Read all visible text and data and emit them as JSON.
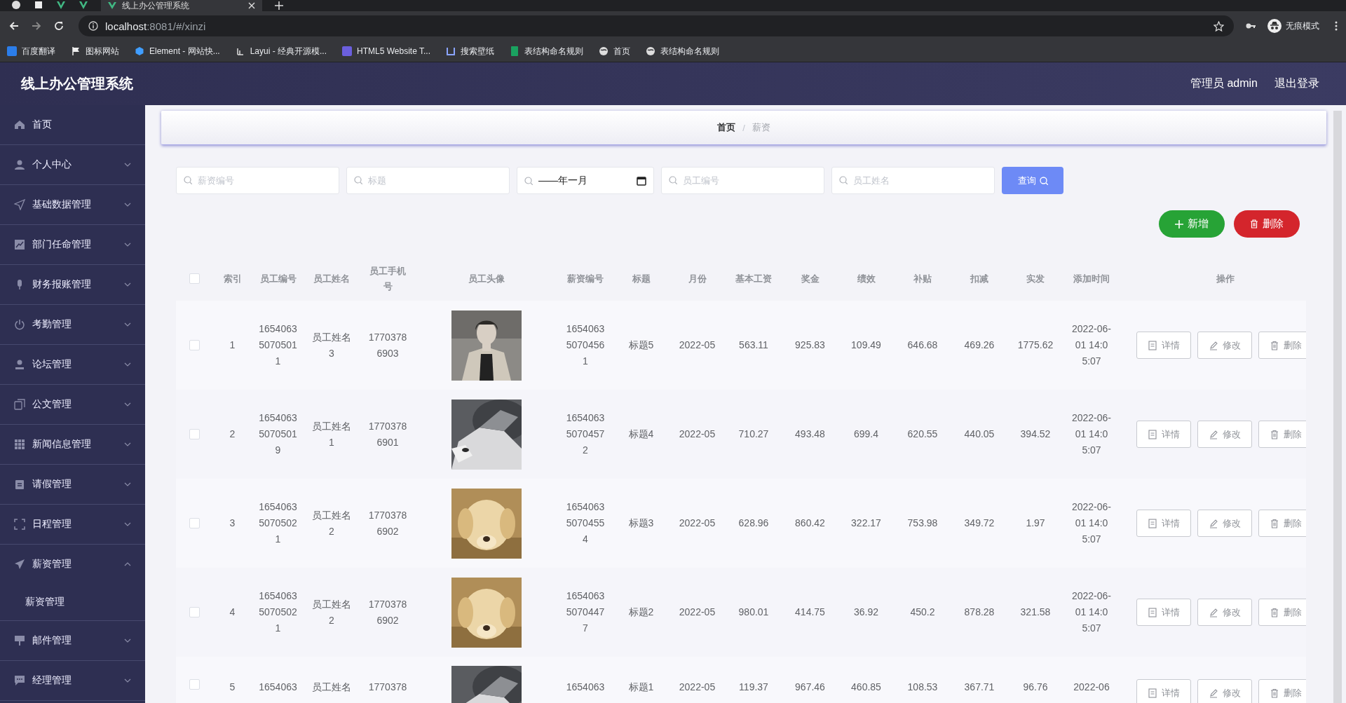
{
  "browser": {
    "tab": {
      "title": "线上办公管理系统",
      "selected": true
    },
    "url_host": "localhost",
    "url_path": ":8081/#/xinzi",
    "profile": "无痕模式",
    "bookmarks": [
      "百度翻译",
      "图标网站",
      "Element - 网站快...",
      "Layui - 经典开源模...",
      "HTML5 Website T...",
      "搜索壁纸",
      "表结构命名规则",
      "首页",
      "表结构命名规则"
    ]
  },
  "header": {
    "title": "线上办公管理系统",
    "user": "管理员 admin",
    "logout": "退出登录"
  },
  "sidebar": {
    "items": [
      {
        "label": "首页",
        "kind": "link"
      },
      {
        "label": "个人中心",
        "kind": "menu",
        "expanded": false
      },
      {
        "label": "基础数据管理",
        "kind": "menu",
        "expanded": false
      },
      {
        "label": "部门任命管理",
        "kind": "menu",
        "expanded": false
      },
      {
        "label": "财务报账管理",
        "kind": "menu",
        "expanded": false
      },
      {
        "label": "考勤管理",
        "kind": "menu",
        "expanded": false
      },
      {
        "label": "论坛管理",
        "kind": "menu",
        "expanded": false
      },
      {
        "label": "公文管理",
        "kind": "menu",
        "expanded": false
      },
      {
        "label": "新闻信息管理",
        "kind": "menu",
        "expanded": false
      },
      {
        "label": "请假管理",
        "kind": "menu",
        "expanded": false
      },
      {
        "label": "日程管理",
        "kind": "menu",
        "expanded": false
      },
      {
        "label": "薪资管理",
        "kind": "menu",
        "expanded": true,
        "children": [
          {
            "label": "薪资管理"
          }
        ]
      },
      {
        "label": "邮件管理",
        "kind": "menu",
        "expanded": false
      },
      {
        "label": "经理管理",
        "kind": "menu",
        "expanded": false
      }
    ]
  },
  "breadcrumb": [
    "首页",
    "薪资"
  ],
  "breadcrumb_separator": "/",
  "filters": [
    {
      "kind": "text",
      "placeholder": "薪资编号"
    },
    {
      "kind": "text",
      "placeholder": "标题"
    },
    {
      "kind": "month",
      "placeholder": "——年一月"
    },
    {
      "kind": "text",
      "placeholder": "员工编号"
    },
    {
      "kind": "text",
      "placeholder": "员工姓名"
    }
  ],
  "search_button": "查询",
  "add_button": "新增",
  "delete_button": "删除",
  "table": {
    "select_all": {
      "checked": false
    },
    "columns": [
      "索引",
      "员工编号",
      "员工姓名",
      "员工手机号",
      "员工头像",
      "薪资编号",
      "标题",
      "月份",
      "基本工资",
      "奖金",
      "绩效",
      "补贴",
      "扣减",
      "实发",
      "添加时间",
      "操作"
    ],
    "rows": [
      {
        "checked": false,
        "cells": [
          "1",
          "165406350705011",
          "员工姓名3",
          "17703786903",
          {
            "kind": "picture"
          },
          "165406350704561",
          "标题5",
          "2022-05",
          "563.11",
          "925.83",
          "109.49",
          "646.68",
          "469.26",
          "1775.62",
          "2022-06-01 14:05:07"
        ],
        "actions": [
          "详情",
          "修改",
          "删除"
        ]
      },
      {
        "checked": false,
        "cells": [
          "2",
          "165406350705019",
          "员工姓名1",
          "17703786901",
          {
            "kind": "picture"
          },
          "165406350704572",
          "标题4",
          "2022-05",
          "710.27",
          "493.48",
          "699.4",
          "620.55",
          "440.05",
          "394.52",
          "2022-06-01 14:05:07"
        ],
        "actions": [
          "详情",
          "修改",
          "删除"
        ]
      },
      {
        "checked": false,
        "cells": [
          "3",
          "165406350705021",
          "员工姓名2",
          "17703786902",
          {
            "kind": "picture"
          },
          "165406350704554",
          "标题3",
          "2022-05",
          "628.96",
          "860.42",
          "322.17",
          "753.98",
          "349.72",
          "1.97",
          "2022-06-01 14:05:07"
        ],
        "actions": [
          "详情",
          "修改",
          "删除"
        ]
      },
      {
        "checked": false,
        "cells": [
          "4",
          "165406350705021",
          "员工姓名2",
          "17703786902",
          {
            "kind": "picture"
          },
          "165406350704477",
          "标题2",
          "2022-05",
          "980.01",
          "414.75",
          "36.92",
          "450.2",
          "878.28",
          "321.58",
          "2022-06-01 14:05:07"
        ],
        "actions": [
          "详情",
          "修改",
          "删除"
        ]
      },
      {
        "checked": false,
        "cells": [
          "5",
          "1654063",
          "员工姓名",
          "1770378",
          {
            "kind": "picture"
          },
          "1654063",
          "标题1",
          "2022-05",
          "119.37",
          "967.46",
          "460.85",
          "108.53",
          "367.71",
          "96.76",
          "2022-06"
        ],
        "actions": [
          "详情",
          "修改",
          "删除"
        ]
      }
    ]
  }
}
